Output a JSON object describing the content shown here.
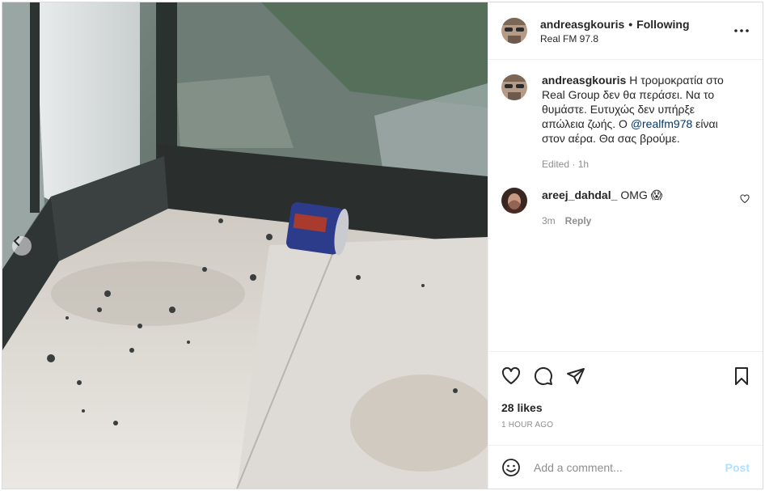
{
  "post": {
    "author": {
      "username": "andreasgkouris",
      "follow_status": "Following",
      "separator": "•",
      "location": "Real FM 97.8"
    },
    "caption": {
      "text_before_mention": "Η τρομοκρατία στο Real Group δεν θα περάσει. Να το θυμάστε. Ευτυχώς δεν υπήρξε απώλεια ζωής. Ο ",
      "mention": "@realfm978",
      "text_after_mention": " είναι στον αέρα. Θα σας βρούμε.",
      "edited_label": "Edited · 1h"
    },
    "comments": [
      {
        "username": "areej_dahdal_",
        "text": "OMG 😱",
        "age": "3m",
        "reply_label": "Reply"
      }
    ],
    "likes_label": "28 likes",
    "posted_ago": "1 hour ago",
    "add_comment": {
      "placeholder": "Add a comment...",
      "post_label": "Post"
    }
  },
  "icons": {
    "more": "more-options-icon",
    "like": "heart-icon",
    "comment": "comment-icon",
    "share": "send-icon",
    "save": "bookmark-icon",
    "emoji": "emoji-icon",
    "carousel_prev": "chevron-left-icon"
  },
  "colors": {
    "mention": "#00376b",
    "post_disabled": "#b2dffc",
    "muted_text": "#8e8e8e",
    "border": "#efefef"
  }
}
